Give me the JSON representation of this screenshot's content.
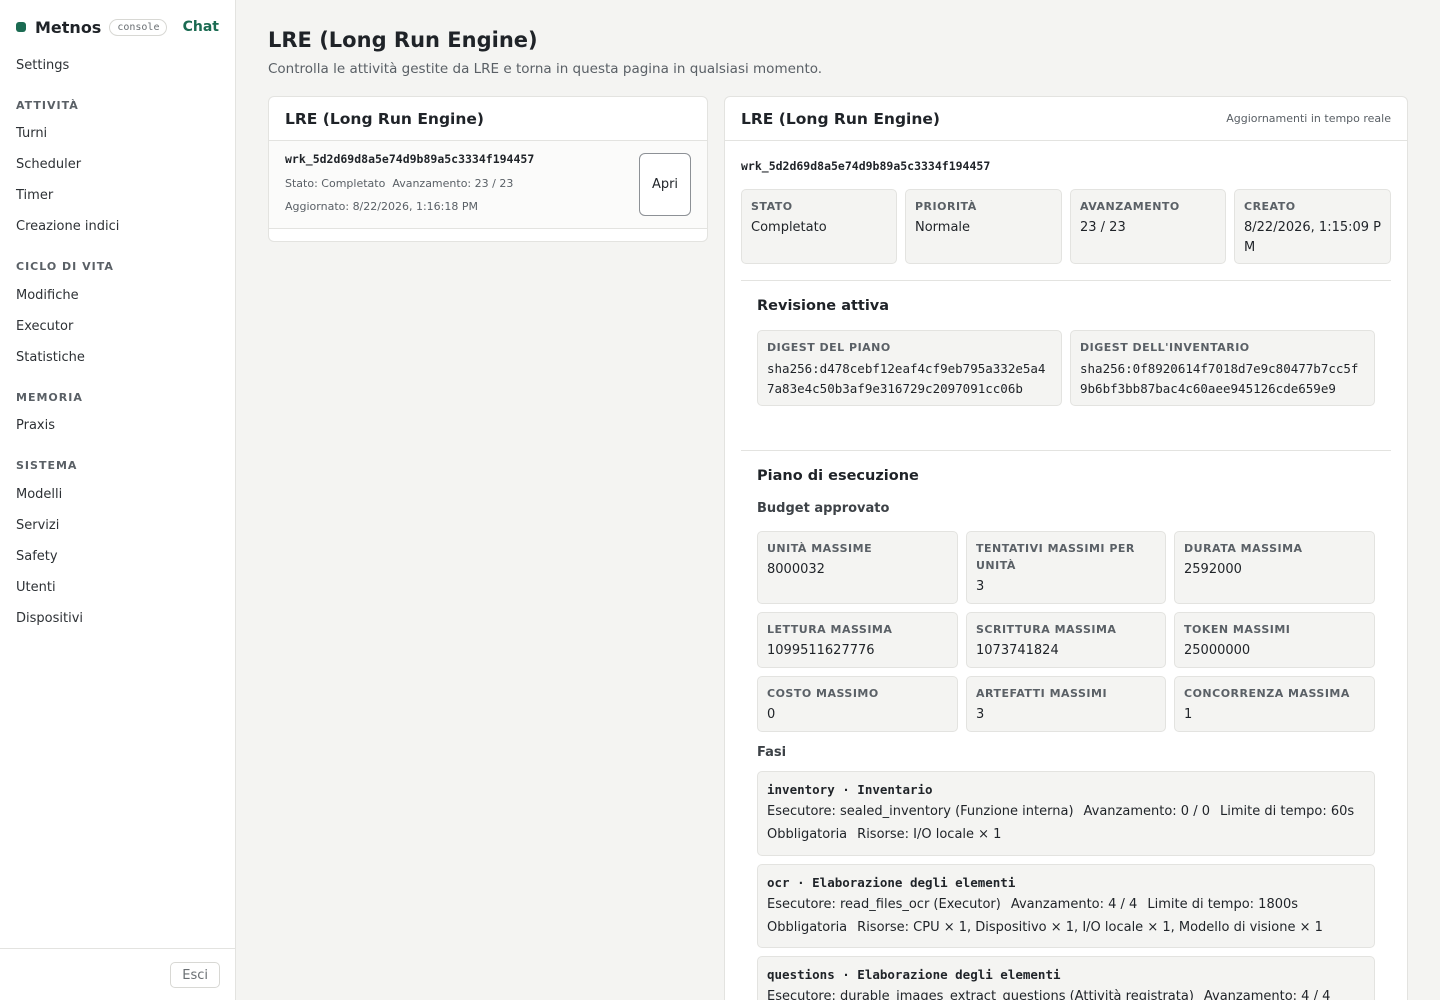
{
  "sidebar": {
    "brand": "Metnos",
    "badge": "console",
    "chat": "Chat",
    "settings": "Settings",
    "sections": {
      "attivita": "ATTIVITÀ",
      "ciclo": "CICLO DI VITA",
      "memoria": "MEMORIA",
      "sistema": "SISTEMA"
    },
    "items": {
      "turni": "Turni",
      "scheduler": "Scheduler",
      "timer": "Timer",
      "creazione_indici": "Creazione indici",
      "modifiche": "Modifiche",
      "executor": "Executor",
      "statistiche": "Statistiche",
      "praxis": "Praxis",
      "modelli": "Modelli",
      "servizi": "Servizi",
      "safety": "Safety",
      "utenti": "Utenti",
      "dispositivi": "Dispositivi"
    },
    "logout": "Esci"
  },
  "header": {
    "title": "LRE (Long Run Engine)",
    "subtitle": "Controlla le attività gestite da LRE e torna in questa pagina in qualsiasi momento."
  },
  "list_panel": {
    "title": "LRE (Long Run Engine)",
    "task": {
      "id": "wrk_5d2d69d8a5e74d9b89a5c3334f194457",
      "status": "Stato: Completato",
      "progress": "Avanzamento: 23 / 23",
      "updated": "Aggiornato: 8/22/2026, 1:16:18 PM",
      "open": "Apri"
    }
  },
  "detail": {
    "title": "LRE (Long Run Engine)",
    "live_note": "Aggiornamenti in tempo reale",
    "id": "wrk_5d2d69d8a5e74d9b89a5c3334f194457",
    "stats": [
      {
        "label": "STATO",
        "value": "Completato"
      },
      {
        "label": "PRIORITÀ",
        "value": "Normale"
      },
      {
        "label": "AVANZAMENTO",
        "value": "23 / 23"
      },
      {
        "label": "CREATO",
        "value": "8/22/2026, 1:15:09 PM"
      }
    ],
    "revision": {
      "title": "Revisione attiva",
      "plan_digest_label": "DIGEST DEL PIANO",
      "plan_digest": "sha256:d478cebf12eaf4cf9eb795a332e5a47a83e4c50b3af9e316729c2097091cc06b",
      "inventory_digest_label": "DIGEST DELL'INVENTARIO",
      "inventory_digest": "sha256:0f8920614f7018d7e9c80477b7cc5f9b6bf3bb87bac4c60aee945126cde659e9"
    },
    "plan": {
      "title": "Piano di esecuzione",
      "budget_title": "Budget approvato",
      "budget": [
        {
          "label": "UNITÀ MASSIME",
          "value": "8000032"
        },
        {
          "label": "TENTATIVI MASSIMI PER UNITÀ",
          "value": "3"
        },
        {
          "label": "DURATA MASSIMA",
          "value": "2592000"
        },
        {
          "label": "LETTURA MASSIMA",
          "value": "1099511627776"
        },
        {
          "label": "SCRITTURA MASSIMA",
          "value": "1073741824"
        },
        {
          "label": "TOKEN MASSIMI",
          "value": "25000000"
        },
        {
          "label": "COSTO MASSIMO",
          "value": "0"
        },
        {
          "label": "ARTEFATTI MASSIMI",
          "value": "3"
        },
        {
          "label": "CONCORRENZA MASSIMA",
          "value": "1"
        }
      ],
      "phases_title": "Fasi",
      "phases": [
        {
          "title": "inventory · Inventario",
          "executor": "Esecutore: sealed_inventory (Funzione interna)",
          "progress": "Avanzamento: 0 / 0",
          "time_limit": "Limite di tempo: 60s",
          "required": "Obbligatoria",
          "resources": "Risorse: I/O locale × 1"
        },
        {
          "title": "ocr · Elaborazione degli elementi",
          "executor": "Esecutore: read_files_ocr (Executor)",
          "progress": "Avanzamento: 4 / 4",
          "time_limit": "Limite di tempo: 1800s",
          "required": "Obbligatoria",
          "resources": "Risorse: CPU × 1, Dispositivo × 1, I/O locale × 1, Modello di visione × 1"
        },
        {
          "title": "questions · Elaborazione degli elementi",
          "executor": "Esecutore: durable_images_extract_questions (Attività registrata)",
          "progress": "Avanzamento: 4 / 4"
        }
      ]
    }
  }
}
